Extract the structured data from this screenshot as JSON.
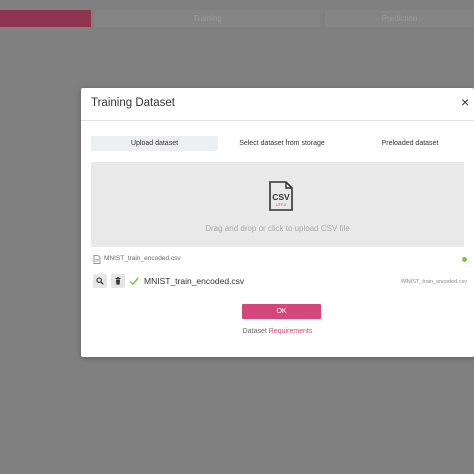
{
  "background": {
    "steps": [
      {
        "label": ""
      },
      {
        "label": "Training"
      },
      {
        "label": "Prediction"
      }
    ]
  },
  "modal": {
    "title": "Training Dataset",
    "close_symbol": "×",
    "tabs": [
      {
        "label": "Upload dataset",
        "active": true
      },
      {
        "label": "Select dataset from storage",
        "active": false
      },
      {
        "label": "Preloaded dataset",
        "active": false
      }
    ],
    "dropzone": {
      "icon": "csv-file-icon",
      "icon_text": "CSV",
      "icon_subtext": "UTF-8",
      "text": "Drag and drop or click to upload CSV file"
    },
    "selected_file": {
      "icon": "document-icon",
      "name": "MNIST_train_encoded.csv",
      "status_color": "#7cc24b"
    },
    "upload_row": {
      "name": "MNIST_train_encoded.csv",
      "path": "/MNIST_train_encoded.csv"
    },
    "ok_label": "OK",
    "requirements_prefix": "Dataset",
    "requirements_link": "Requirements"
  },
  "colors": {
    "accent": "#d4477a",
    "step_active": "#8f3552",
    "overlay": "#808080"
  }
}
